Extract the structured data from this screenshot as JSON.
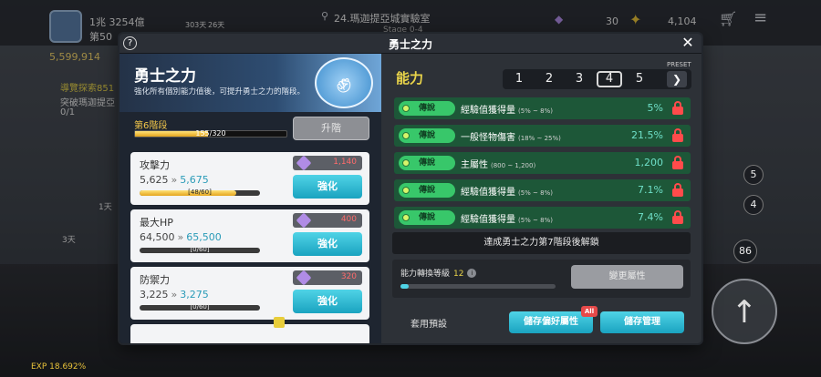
{
  "hud": {
    "currency_top": "1兆 3254億",
    "level_label": "第50",
    "mesos": "5,599,914",
    "map_name": "24.瑪迦提亞城實驗室",
    "stage": "Stage 0-4",
    "timer_a": "303天",
    "timer_b": "26天",
    "gem_count": "30",
    "power": "4,104",
    "quest_title": "導覽探索851",
    "quest_desc": "突破瑪迦提亞",
    "quest_progress": "0/1",
    "item_days_a": "1天",
    "item_days_b": "3天",
    "side_numbers": [
      "5",
      "4",
      "86"
    ],
    "exp": "EXP 18.692%"
  },
  "modal": {
    "title": "勇士之力",
    "close": "✕",
    "help": "?"
  },
  "left": {
    "banner_title": "勇士之力",
    "banner_desc": "強化所有個別能力值後，可提升勇士之力的階段。",
    "stage_label": "第6階段",
    "stage_progress_text": "155/320",
    "stage_progress": 0.484,
    "upgrade_label": "升階",
    "cards": [
      {
        "name": "攻擊力",
        "from": "5,625",
        "to": "5,675",
        "progress_text": "[48/60]",
        "progress": 0.8,
        "cost": "1,140",
        "button": "強化"
      },
      {
        "name": "最大HP",
        "from": "64,500",
        "to": "65,500",
        "progress_text": "[0/60]",
        "progress": 0.0,
        "cost": "400",
        "button": "強化"
      },
      {
        "name": "防禦力",
        "from": "3,225",
        "to": "3,275",
        "progress_text": "[0/60]",
        "progress": 0.0,
        "cost": "320",
        "button": "強化"
      }
    ]
  },
  "right": {
    "ability_title": "能力",
    "preset_label": "PRESET",
    "presets": [
      "1",
      "2",
      "3",
      "4",
      "5"
    ],
    "selected_preset": "4",
    "next": "❯",
    "rows": [
      {
        "rarity": "傳說",
        "name": "經驗值獲得量",
        "range": "(5% ~ 8%)",
        "value": "5%"
      },
      {
        "rarity": "傳說",
        "name": "一般怪物傷害",
        "range": "(18% ~ 25%)",
        "value": "21.5%"
      },
      {
        "rarity": "傳說",
        "name": "主屬性",
        "range": "(800 ~ 1,200)",
        "value": "1,200"
      },
      {
        "rarity": "傳說",
        "name": "經驗值獲得量",
        "range": "(5% ~ 8%)",
        "value": "7.1%"
      },
      {
        "rarity": "傳說",
        "name": "經驗值獲得量",
        "range": "(5% ~ 8%)",
        "value": "7.4%"
      }
    ],
    "unlock_text": "達成勇士之力第7階段後解鎖",
    "conversion_label": "能力轉換等級",
    "conversion_level": "12",
    "conversion_progress": 0.05,
    "change_button": "變更屬性",
    "use_preset": "套用預設",
    "save_fav": "儲存偏好屬性",
    "all_badge": "All",
    "save_mgmt": "儲存管理"
  }
}
